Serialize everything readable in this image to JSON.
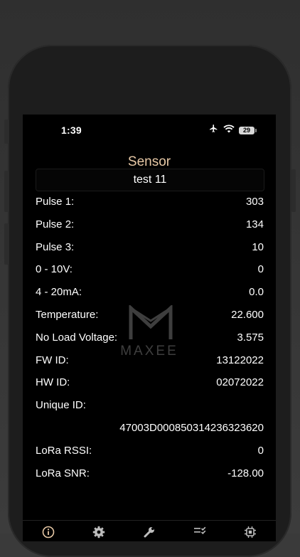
{
  "status_bar": {
    "time": "1:39",
    "battery": "29"
  },
  "header": {
    "title": "Sensor",
    "device_name": "test 11"
  },
  "readings": [
    {
      "label": "Pulse 1:",
      "value": "303"
    },
    {
      "label": "Pulse 2:",
      "value": "134"
    },
    {
      "label": "Pulse 3:",
      "value": "10"
    },
    {
      "label": "0 - 10V:",
      "value": "0"
    },
    {
      "label": "4 - 20mA:",
      "value": "0.0"
    },
    {
      "label": "Temperature:",
      "value": "22.600"
    },
    {
      "label": "No Load Voltage:",
      "value": "3.575"
    },
    {
      "label": "FW ID:",
      "value": "13122022"
    },
    {
      "label": "HW ID:",
      "value": "02072022"
    },
    {
      "label": "Unique ID:",
      "value": ""
    },
    {
      "label": "",
      "value": "47003D000850314236323620"
    },
    {
      "label": "LoRa RSSI:",
      "value": "0"
    },
    {
      "label": "LoRa SNR:",
      "value": "-128.00"
    }
  ],
  "watermark": {
    "text": "MAXEE"
  },
  "tabs": [
    {
      "icon": "info-icon",
      "active": true
    },
    {
      "icon": "gear-icon",
      "active": false
    },
    {
      "icon": "wrench-icon",
      "active": false
    },
    {
      "icon": "checklist-icon",
      "active": false
    },
    {
      "icon": "chip-icon",
      "active": false
    }
  ],
  "colors": {
    "title": "#e8c9a6",
    "active_tab": "#e8c9a6",
    "inactive_tab": "#bdbdbd"
  }
}
